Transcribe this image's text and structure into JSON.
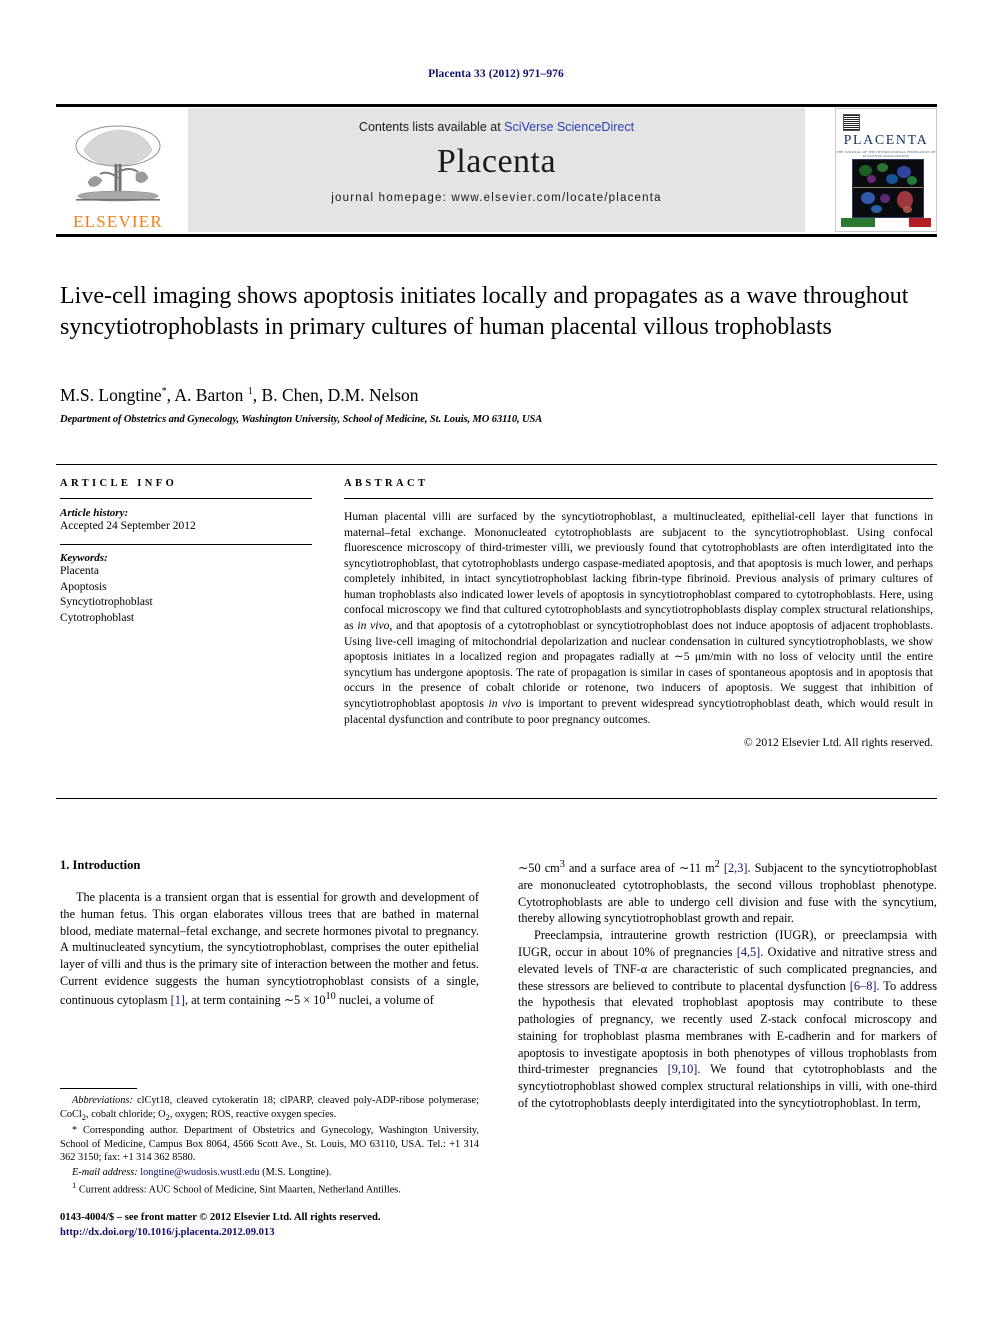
{
  "journal_reference": "Placenta 33 (2012) 971–976",
  "masthead": {
    "contents_prefix": "Contents lists available at ",
    "sciverse_link": "SciVerse ScienceDirect",
    "journal_name": "Placenta",
    "homepage": "journal homepage: www.elsevier.com/locate/placenta",
    "publisher_logo_text": "ELSEVIER",
    "cover_title": "PLACENTA",
    "cover_subtitle": "THE JOURNAL OF THE INTERNATIONAL FEDERATION OF PLACENTA ASSOCIATIONS"
  },
  "article": {
    "title": "Live-cell imaging shows apoptosis initiates locally and propagates as a wave throughout syncytiotrophoblasts in primary cultures of human placental villous trophoblasts",
    "authors_html": "M.S. Longtine<sup>*</sup>, A. Barton <sup class=\"blue\">1</sup>, B. Chen, D.M. Nelson",
    "affiliation": "Department of Obstetrics and Gynecology, Washington University, School of Medicine, St. Louis, MO 63110, USA"
  },
  "article_info": {
    "heading": "ARTICLE INFO",
    "history_label": "Article history:",
    "history_value": "Accepted 24 September 2012",
    "keywords_label": "Keywords:",
    "keywords": [
      "Placenta",
      "Apoptosis",
      "Syncytiotrophoblast",
      "Cytotrophoblast"
    ]
  },
  "abstract": {
    "heading": "ABSTRACT",
    "body_html": "Human placental villi are surfaced by the syncytiotrophoblast, a multinucleated, epithelial-cell layer that functions in maternal–fetal exchange. Mononucleated cytotrophoblasts are subjacent to the syncytiotrophoblast. Using confocal fluorescence microscopy of third-trimester villi, we previously found that cytotrophoblasts are often interdigitated into the syncytiotrophoblast, that cytotrophoblasts undergo caspase-mediated apoptosis, and that apoptosis is much lower, and perhaps completely inhibited, in intact syncytiotrophoblast lacking fibrin-type fibrinoid. Previous analysis of primary cultures of human trophoblasts also indicated lower levels of apoptosis in syncytiotrophoblast compared to cytotrophoblasts. Here, using confocal microscopy we find that cultured cytotrophoblasts and syncytiotrophoblasts display complex structural relationships, as <i>in vivo</i>, and that apoptosis of a cytotrophoblast or syncytiotrophoblast does not induce apoptosis of adjacent trophoblasts. Using live-cell imaging of mitochondrial depolarization and nuclear condensation in cultured syncytiotrophoblasts, we show apoptosis initiates in a localized region and propagates radially at ∼5 μm/min with no loss of velocity until the entire syncytium has undergone apoptosis. The rate of propagation is similar in cases of spontaneous apoptosis and in apoptosis that occurs in the presence of cobalt chloride or rotenone, two inducers of apoptosis. We suggest that inhibition of syncytiotrophoblast apoptosis <i>in vivo</i> is important to prevent widespread syncytiotrophoblast death, which would result in placental dysfunction and contribute to poor pregnancy outcomes.",
    "copyright": "© 2012 Elsevier Ltd. All rights reserved."
  },
  "introduction": {
    "section_title": "1. Introduction",
    "left_paragraph_html": "The placenta is a transient organ that is essential for growth and development of the human fetus. This organ elaborates villous trees that are bathed in maternal blood, mediate maternal–fetal exchange, and secrete hormones pivotal to pregnancy. A multinucleated syncytium, the syncytiotrophoblast, comprises the outer epithelial layer of villi and thus is the primary site of interaction between the mother and fetus. Current evidence suggests the human syncytiotrophoblast consists of a single, continuous cytoplasm <span class=\"ref\">[1]</span>, at term containing ∼5 × 10<sup>10</sup> nuclei, a volume of",
    "right_paragraph_1_html": "∼50 cm<sup>3</sup> and a surface area of ∼11 m<sup>2</sup> <span class=\"ref\">[2,3]</span>. Subjacent to the syncytiotrophoblast are mononucleated cytotrophoblasts, the second villous trophoblast phenotype. Cytotrophoblasts are able to undergo cell division and fuse with the syncytium, thereby allowing syncytiotrophoblast growth and repair.",
    "right_paragraph_2_html": "Preeclampsia, intrauterine growth restriction (IUGR), or preeclampsia with IUGR, occur in about 10% of pregnancies <span class=\"ref\">[4,5]</span>. Oxidative and nitrative stress and elevated levels of TNF-α are characteristic of such complicated pregnancies, and these stressors are believed to contribute to placental dysfunction <span class=\"ref\">[6–8]</span>. To address the hypothesis that elevated trophoblast apoptosis may contribute to these pathologies of pregnancy, we recently used Z-stack confocal microscopy and staining for trophoblast plasma membranes with E-cadherin and for markers of apoptosis to investigate apoptosis in both phenotypes of villous trophoblasts from third-trimester pregnancies <span class=\"ref\">[9,10]</span>. We found that cytotrophoblasts and the syncytiotrophoblast showed complex structural relationships in villi, with one-third of the cytotrophoblasts deeply interdigitated into the syncytiotrophoblast. In term,"
  },
  "footnotes": {
    "abbreviations_html": "<i>Abbreviations:</i> clCyt18, cleaved cytokeratin 18; clPARP, cleaved poly-ADP-ribose polymerase; CoCl<sub>2</sub>, cobalt chloride; O<sub>2</sub>, oxygen; ROS, reactive oxygen species.",
    "corresponding_html": "* Corresponding author. Department of Obstetrics and Gynecology, Washington University, School of Medicine, Campus Box 8064, 4566 Scott Ave., St. Louis, MO 63110, USA. Tel.: +1 314 362 3150; fax: +1 314 362 8580.",
    "email_html": "<i>E-mail address:</i> <span class=\"mail-link\">longtine@wudosis.wustl.edu</span> (M.S. Longtine).",
    "current_address_html": "<sup>1</sup> Current address: AUC School of Medicine, Sint Maarten, Netherland Antilles."
  },
  "bottom": {
    "issn_line": "0143-4004/$ – see front matter © 2012 Elsevier Ltd. All rights reserved.",
    "doi": "http://dx.doi.org/10.1016/j.placenta.2012.09.013"
  },
  "colors": {
    "link_blue": "#10106b",
    "sciverse_blue": "#2b3fae",
    "elsevier_orange": "#f07f1a",
    "masthead_gray": "#e4e4e4"
  }
}
